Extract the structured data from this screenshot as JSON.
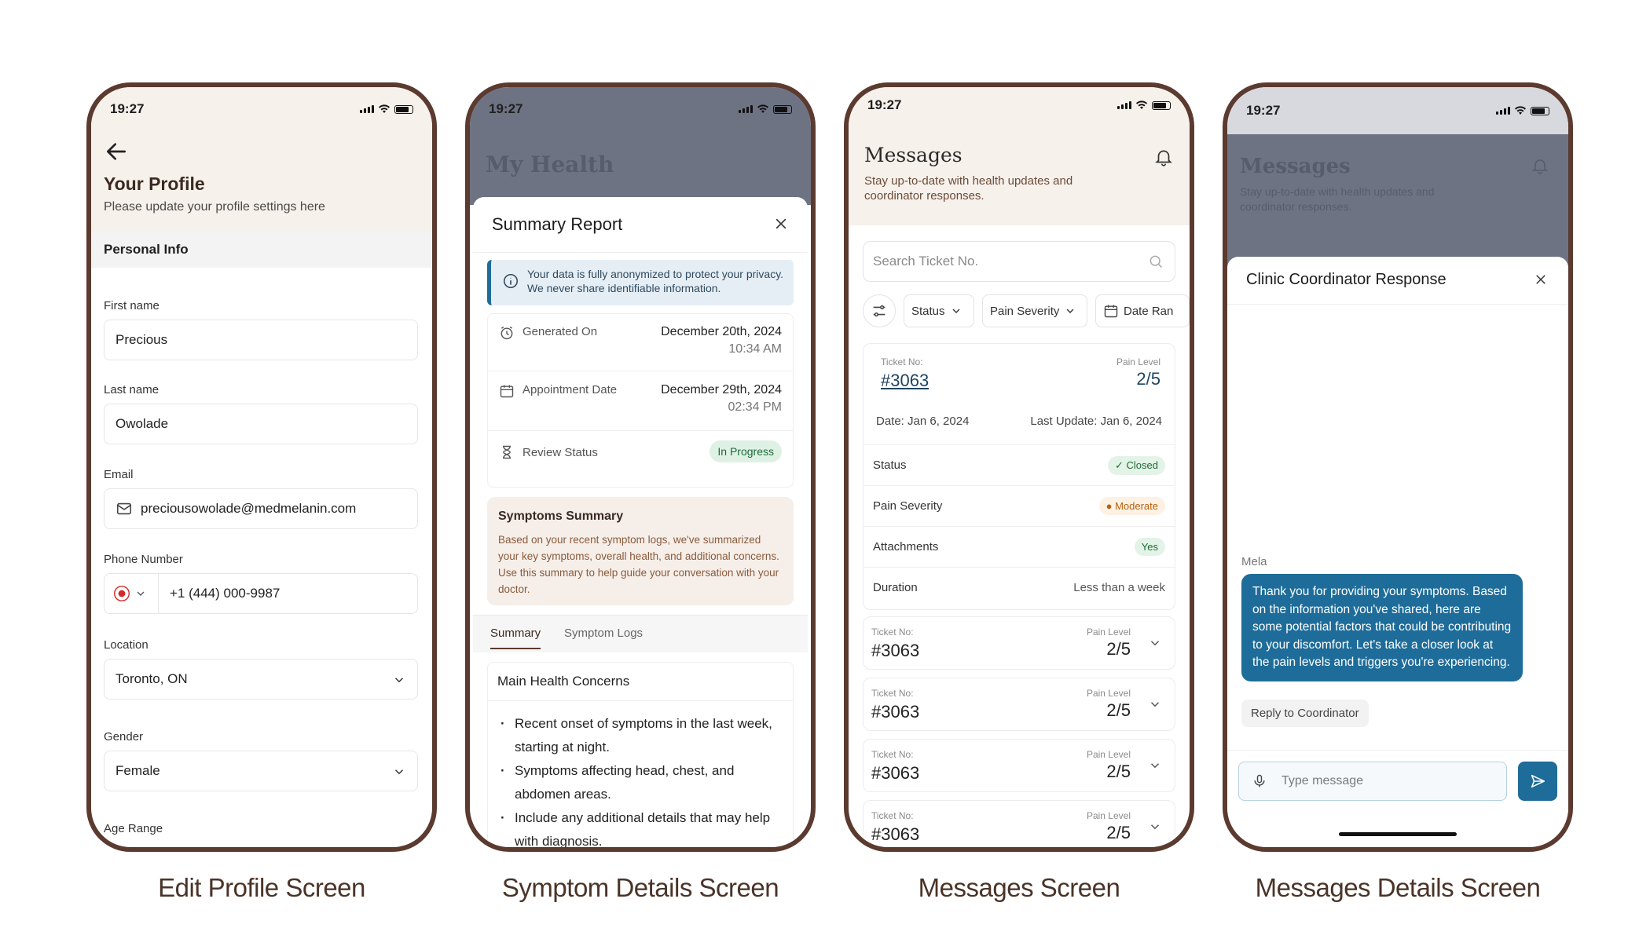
{
  "statusbar": {
    "time": "19:27"
  },
  "captions": [
    "Edit Profile Screen",
    "Symptom Details Screen",
    "Messages Screen",
    "Messages Details Screen"
  ],
  "profile": {
    "title": "Your Profile",
    "subtitle": "Please update your profile settings here",
    "section": "Personal Info",
    "first_name_label": "First name",
    "first_name": "Precious",
    "last_name_label": "Last name",
    "last_name": "Owolade",
    "email_label": "Email",
    "email": "preciousowolade@medmelanin.com",
    "phone_label": "Phone Number",
    "phone": "+1 (444) 000-9987",
    "location_label": "Location",
    "location": "Toronto, ON",
    "gender_label": "Gender",
    "gender": "Female",
    "age_label": "Age Range",
    "icons": [
      "arrow-left-icon",
      "mail-icon",
      "flag-icon",
      "chevron-down-icon"
    ]
  },
  "summary": {
    "bg_title": "My Health",
    "title": "Summary Report",
    "notice": "Your data is fully anonymized to protect your privacy. We never share identifiable information.",
    "generated_label": "Generated On",
    "generated_date": "December 20th, 2024",
    "generated_time": "10:34 AM",
    "appointment_label": "Appointment Date",
    "appointment_date": "December 29th, 2024",
    "appointment_time": "02:34 PM",
    "review_label": "Review Status",
    "review_status": "In Progress",
    "symptoms_title": "Symptoms Summary",
    "symptoms_text": "Based on your recent symptom logs, we've summarized your key symptoms, overall health, and additional concerns. Use this summary to help guide your conversation with your doctor.",
    "tabs": [
      "Summary",
      "Symptom Logs"
    ],
    "concerns_title": "Main Health Concerns",
    "concerns": [
      "Recent onset of symptoms in the last week, starting at night.",
      "Symptoms affecting head, chest, and abdomen areas.",
      "Include any additional details that may help with diagnosis."
    ]
  },
  "messages": {
    "title": "Messages",
    "subtitle": "Stay up-to-date with health updates and coordinator responses.",
    "search_placeholder": "Search Ticket No.",
    "filters": [
      "Status",
      "Pain Severity",
      "Date Ran"
    ],
    "ticket_label": "Ticket No:",
    "pain_label": "Pain Level",
    "expanded": {
      "ticket": "#3063",
      "pain": "2/5",
      "date": "Date: Jan 6, 2024",
      "update": "Last Update: Jan 6, 2024",
      "status_label": "Status",
      "status": "Closed",
      "severity_label": "Pain Severity",
      "severity": "Moderate",
      "attach_label": "Attachments",
      "attach": "Yes",
      "duration_label": "Duration",
      "duration": "Less than a week"
    },
    "tickets": [
      {
        "ticket": "#3063",
        "pain": "2/5"
      },
      {
        "ticket": "#3063",
        "pain": "2/5"
      },
      {
        "ticket": "#3063",
        "pain": "2/5"
      },
      {
        "ticket": "#3063",
        "pain": "2/5"
      }
    ]
  },
  "detail": {
    "bg_title": "Messages",
    "bg_subtitle": "Stay up-to-date with health updates and coordinator responses.",
    "title": "Clinic Coordinator Response",
    "sender": "Mela",
    "message": "Thank you for providing your symptoms. Based on the information you've shared, here are some potential factors that could be contributing to your discomfort. Let's take a closer look at the pain levels and triggers you're experiencing.",
    "reply": "Reply to Coordinator",
    "input_placeholder": "Type message"
  },
  "colors": {
    "brand": "#5b3a2f",
    "accent": "#1e6c99",
    "cream": "#f7f1eb"
  }
}
